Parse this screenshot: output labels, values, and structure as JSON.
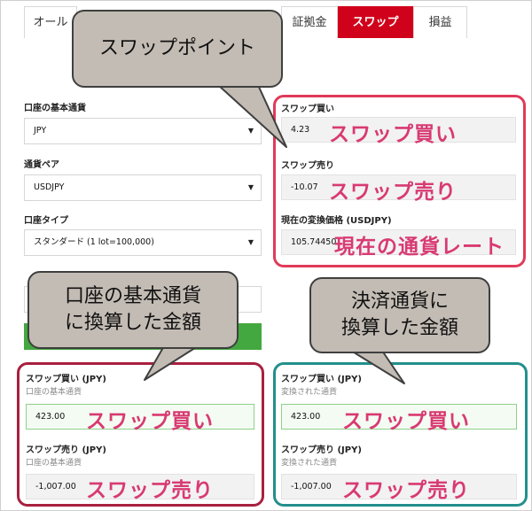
{
  "tabs": [
    {
      "label": "オール"
    },
    {
      "label": "証拠金"
    },
    {
      "label": "スワップ"
    },
    {
      "label": "損益"
    }
  ],
  "form": {
    "base_currency_label": "口座の基本通貨",
    "base_currency_value": "JPY",
    "pair_label": "通貨ペア",
    "pair_value": "USDJPY",
    "account_type_label": "口座タイプ",
    "account_type_value": "スタンダード (1 lot=100,000)"
  },
  "swap": {
    "buy_label": "スワップ買い",
    "buy_value": "4.23",
    "sell_label": "スワップ売り",
    "sell_value": "-10.07",
    "rate_label": "現在の変換価格 (USDJPY)",
    "rate_value": "105.74450"
  },
  "results_base": {
    "buy_label": "スワップ買い (JPY)",
    "buy_sub": "口座の基本通貨",
    "buy_value": "423.00",
    "sell_label": "スワップ売り (JPY)",
    "sell_sub": "口座の基本通貨",
    "sell_value": "-1,007.00"
  },
  "results_converted": {
    "buy_label": "スワップ買い (JPY)",
    "buy_sub": "変換された通貨",
    "buy_value": "423.00",
    "sell_label": "スワップ売り (JPY)",
    "sell_sub": "変換された通貨",
    "sell_value": "-1,007.00"
  },
  "overlays": {
    "swap_buy": "スワップ買い",
    "swap_sell": "スワップ売り",
    "current_rate": "現在の通貨レート"
  },
  "callouts": {
    "swap_points": "スワップポイント",
    "base_currency_line1": "口座の基本通貨",
    "base_currency_line2": "に換算した金額",
    "settlement_line1": "決済通貨に",
    "settlement_line2": "換算した金額"
  },
  "colors": {
    "tab_active": "#d0021b",
    "frame_red": "#e03a5a",
    "frame_crimson": "#a8203f",
    "frame_teal": "#238f8c",
    "overlay_text": "#d83a72",
    "callout_bg": "#c3bcb4",
    "button_green": "#43a83f"
  }
}
